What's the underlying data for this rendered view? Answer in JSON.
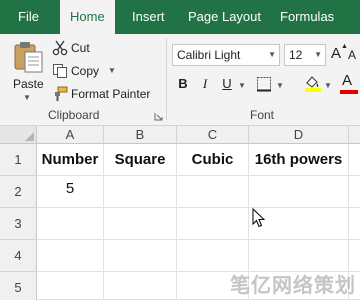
{
  "ribbon_tabs": [
    "File",
    "Home",
    "Insert",
    "Page Layout",
    "Formulas"
  ],
  "active_tab": "Home",
  "clipboard": {
    "paste_label": "Paste",
    "cut_label": "Cut",
    "copy_label": "Copy",
    "format_painter_label": "Format Painter",
    "group_label": "Clipboard"
  },
  "font": {
    "font_name": "Calibri Light",
    "font_size": "12",
    "bold_label": "B",
    "italic_label": "I",
    "underline_label": "U",
    "group_label": "Font"
  },
  "columns": [
    "A",
    "B",
    "C",
    "D"
  ],
  "rows": [
    "1",
    "2",
    "3",
    "4",
    "5"
  ],
  "cells": {
    "A1": "Number",
    "B1": "Square",
    "C1": "Cubic",
    "D1": "16th powers",
    "A2": "5"
  },
  "watermark": "笔亿网络策划",
  "colors": {
    "ribbon_tab_bar": "#217346",
    "ribbon_body": "#f3f3f3",
    "header_bg": "#f0f0f0",
    "gridline": "#e1e1e1"
  }
}
